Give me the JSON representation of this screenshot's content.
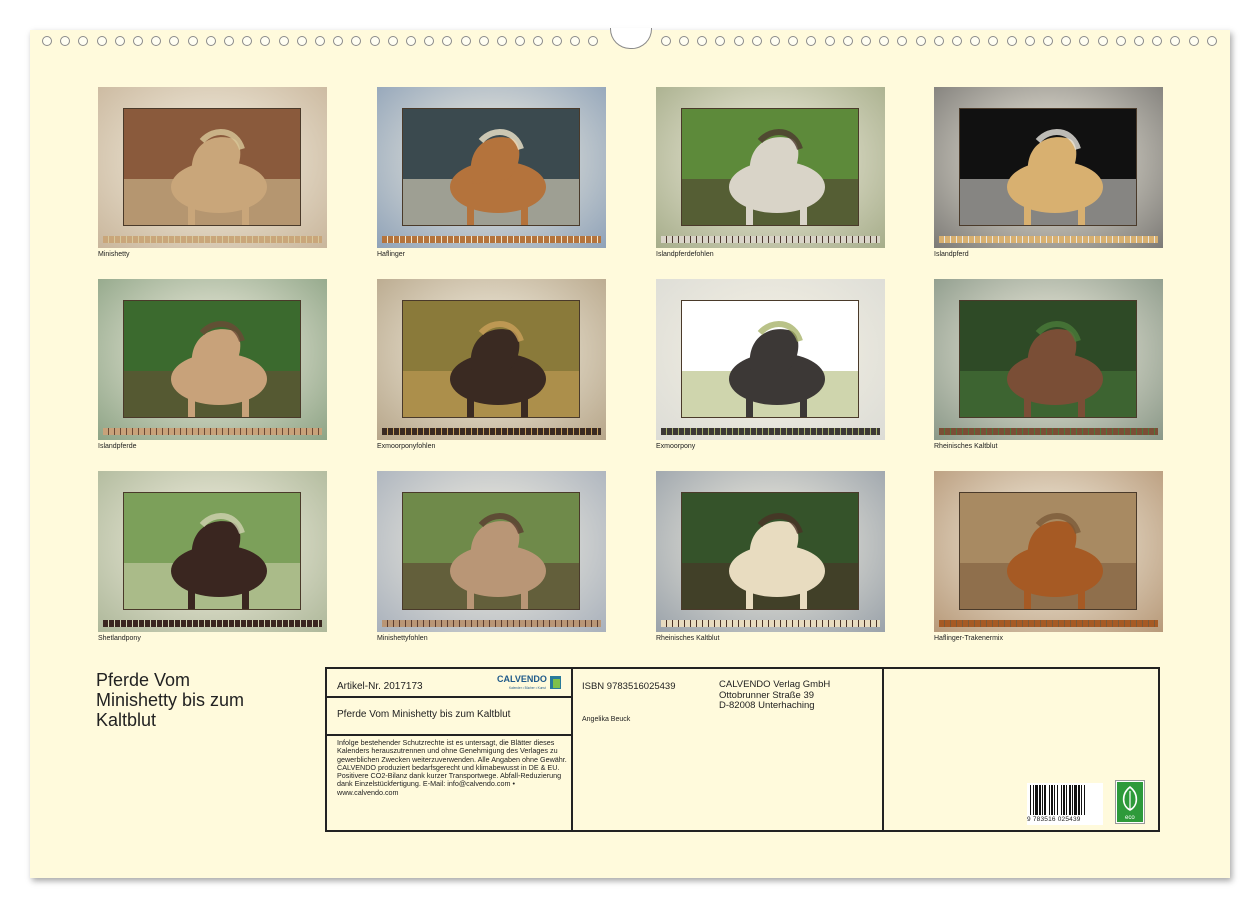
{
  "calendar": {
    "title": "Pferde Vom Minishetty bis zum Kaltblut",
    "title_lines": [
      "Pferde Vom",
      "Minishetty bis zum",
      "Kaltblut"
    ]
  },
  "months": [
    {
      "caption": "Minishetty",
      "scene": "brown-pony",
      "mat": "#c9b69c",
      "colors": [
        "#8a5a3c",
        "#c9a67a",
        "#d8c89a"
      ]
    },
    {
      "caption": "Haflinger",
      "scene": "haflinger",
      "mat": "#8fa2b8",
      "colors": [
        "#3b4a4f",
        "#b4733c",
        "#f0e6cc"
      ]
    },
    {
      "caption": "Islandpferdefohlen",
      "scene": "foal-lying",
      "mat": "#a6ad8a",
      "colors": [
        "#5d8a3a",
        "#d9d4c8",
        "#4e3a30"
      ]
    },
    {
      "caption": "Islandpferd",
      "scene": "night-horse",
      "mat": "#7c7a76",
      "colors": [
        "#111111",
        "#d8b070",
        "#e8e6e0"
      ]
    },
    {
      "caption": "Islandpferde",
      "scene": "herd",
      "mat": "#8ea486",
      "colors": [
        "#3b6a2e",
        "#c8a27a",
        "#6b4a36"
      ]
    },
    {
      "caption": "Exmoorponyfohlen",
      "scene": "exmoor-foal",
      "mat": "#b7a68a",
      "colors": [
        "#8a7a3a",
        "#3a2a22",
        "#c9a05a"
      ]
    },
    {
      "caption": "Exmoorpony",
      "scene": "exmoor",
      "mat": "#dcdcd6",
      "colors": [
        "#ffffff",
        "#3c3836",
        "#a7b36a"
      ]
    },
    {
      "caption": "Rheinisches Kaltblut",
      "scene": "draft-field",
      "mat": "#8a9888",
      "colors": [
        "#2e4a26",
        "#7a4e36",
        "#4a7a3a"
      ]
    },
    {
      "caption": "Shetlandpony",
      "scene": "shetland",
      "mat": "#aeb89a",
      "colors": [
        "#7ca05a",
        "#3a2620",
        "#cfd2b0"
      ]
    },
    {
      "caption": "Minishettyfohlen",
      "scene": "mini-foal",
      "mat": "#a9b1bc",
      "colors": [
        "#6f8a4a",
        "#b99676",
        "#5a3c30"
      ]
    },
    {
      "caption": "Rheinisches Kaltblut",
      "scene": "draft-harness",
      "mat": "#9aa2aa",
      "colors": [
        "#35532a",
        "#e8dcc0",
        "#4a3226"
      ]
    },
    {
      "caption": "Haflinger-Trakenermix",
      "scene": "stone-wall",
      "mat": "#b89a7a",
      "colors": [
        "#a88a62",
        "#a65a24",
        "#7a5a3a"
      ]
    }
  ],
  "info": {
    "article": "Artikel-Nr. 2017173",
    "brand": "CALVENDO",
    "brand_sub": "Kalender • Bücher • Kunst",
    "product_title": "Pferde Vom Minishetty bis zum Kaltblut",
    "isbn": "ISBN 9783516025439",
    "author": "Angelika Beuck",
    "publisher": [
      "CALVENDO Verlag GmbH",
      "Ottobrunner Straße 39",
      "D-82008 Unterhaching"
    ],
    "legal": "Infolge bestehender Schutzrechte ist es untersagt, die Blätter dieses Kalenders herauszutrennen und ohne Genehmigung des Verlages zu gewerblichen Zwecken weiterzuverwenden. Alle Angaben ohne Gewähr. CALVENDO produziert bedarfsgerecht und klimabewusst in DE & EU. Positivere CO2-Bilanz dank kurzer Transportwege. Abfall-Reduzierung dank Einzelstückfertigung. E-Mail: info@calvendo.com • www.calvendo.com",
    "barcode_number": "9 783516 025439",
    "eco_label": "eco"
  }
}
